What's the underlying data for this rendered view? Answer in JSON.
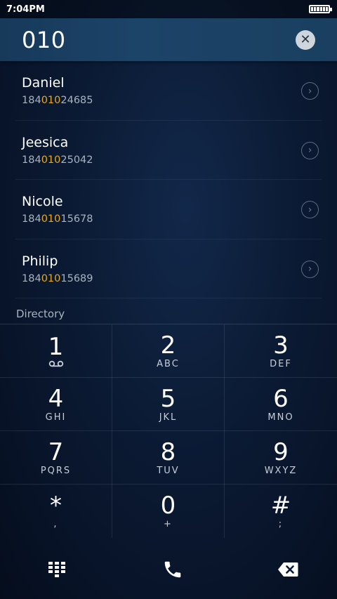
{
  "status_bar": {
    "time": "7:04PM"
  },
  "dialer": {
    "input_value": "010"
  },
  "results": [
    {
      "name": "Daniel",
      "number_prefix": "184",
      "number_match": "010",
      "number_suffix": "24685"
    },
    {
      "name": "Jeesica",
      "number_prefix": "184",
      "number_match": "010",
      "number_suffix": "25042"
    },
    {
      "name": "Nicole",
      "number_prefix": "184",
      "number_match": "010",
      "number_suffix": "15678"
    },
    {
      "name": "Philip",
      "number_prefix": "184",
      "number_match": "010",
      "number_suffix": "15689"
    }
  ],
  "directory_label": "Directory",
  "keypad": [
    {
      "digit": "1",
      "letters": ""
    },
    {
      "digit": "2",
      "letters": "ABC"
    },
    {
      "digit": "3",
      "letters": "DEF"
    },
    {
      "digit": "4",
      "letters": "GHI"
    },
    {
      "digit": "5",
      "letters": "JKL"
    },
    {
      "digit": "6",
      "letters": "MNO"
    },
    {
      "digit": "7",
      "letters": "PQRS"
    },
    {
      "digit": "8",
      "letters": "TUV"
    },
    {
      "digit": "9",
      "letters": "WXYZ"
    },
    {
      "digit": "*",
      "letters": ","
    },
    {
      "digit": "0",
      "letters": "+"
    },
    {
      "digit": "#",
      "letters": ";"
    }
  ],
  "icons": {
    "clear": "close-icon",
    "detail": "chevron-right-icon",
    "voicemail": "voicemail-icon",
    "dialpad": "dialpad-icon",
    "call": "phone-icon",
    "backspace": "backspace-icon"
  },
  "colors": {
    "match_highlight": "#e9a91b",
    "header": "#1c4468"
  }
}
